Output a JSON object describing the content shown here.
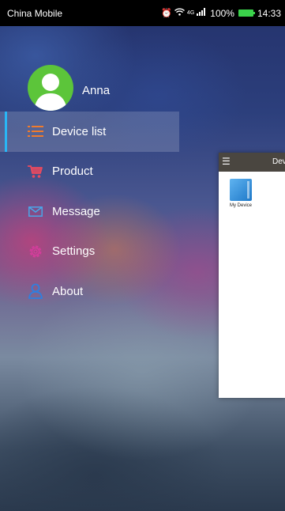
{
  "status_bar": {
    "carrier": "China Mobile",
    "network": "4G",
    "battery": "100%",
    "time": "14:33",
    "icons": [
      "alarm-icon",
      "wifi-icon",
      "signal-icon",
      "battery-icon"
    ]
  },
  "profile": {
    "name": "Anna"
  },
  "menu": {
    "items": [
      {
        "label": "Device list",
        "icon": "list-icon",
        "active": true
      },
      {
        "label": "Product",
        "icon": "cart-icon",
        "active": false
      },
      {
        "label": "Message",
        "icon": "mail-icon",
        "active": false
      },
      {
        "label": "Settings",
        "icon": "gear-icon",
        "active": false
      },
      {
        "label": "About",
        "icon": "person-icon",
        "active": false
      }
    ]
  },
  "preview": {
    "title": "Dev",
    "device_name": "My Device"
  },
  "colors": {
    "active_indicator": "#29b6f6",
    "avatar_bg": "#5cc53a",
    "list_icon": "#f07b2c",
    "cart_icon": "#e84a5f",
    "mail_icon": "#4aa6e8",
    "gear_icon": "#d33d9b",
    "person_icon": "#2f7fe0"
  }
}
